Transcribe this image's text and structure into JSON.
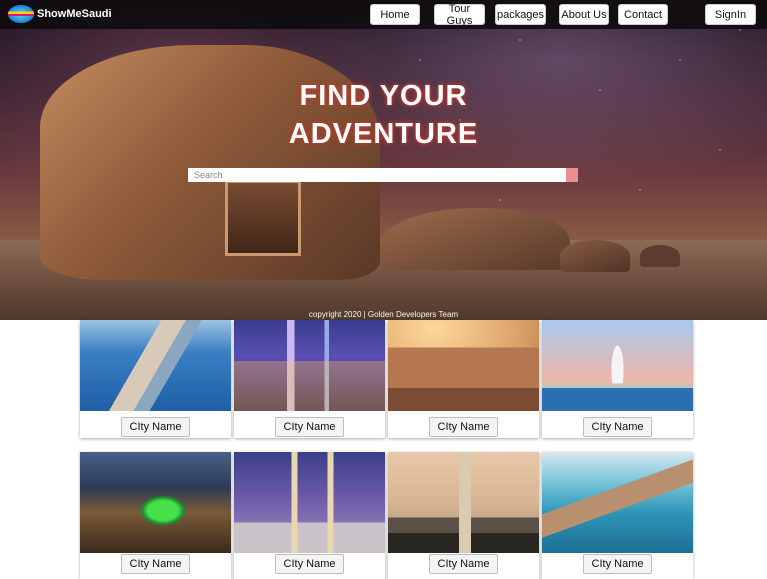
{
  "nav": {
    "brand": "ShowMeSaudi",
    "items": [
      {
        "label": "Home"
      },
      {
        "label": "Tour Guys"
      },
      {
        "label": "packages"
      },
      {
        "label": "About Us"
      },
      {
        "label": "Contact"
      }
    ],
    "signin": "SignIn"
  },
  "hero": {
    "title_line1": "FIND YOUR",
    "title_line2": "ADVENTURE",
    "search_placeholder": "Search",
    "copyright": "copyright 2020 | Golden Developers Team"
  },
  "cards": [
    {
      "button": "CIty Name",
      "image": "jeddah-corniche-aerial"
    },
    {
      "button": "CIty Name",
      "image": "riyadh-night-skyline"
    },
    {
      "button": "CIty Name",
      "image": "alula-tomb"
    },
    {
      "button": "CIty Name",
      "image": "khobar-water-tower"
    },
    {
      "button": "CIty Name",
      "image": "abha-green-lights"
    },
    {
      "button": "CIty Name",
      "image": "madinah-mosque"
    },
    {
      "button": "CIty Name",
      "image": "makkah-clock-tower"
    },
    {
      "button": "CIty Name",
      "image": "coastal-port-aerial"
    }
  ],
  "colors": {
    "nav_bg": "#0f0c0e",
    "title_glow": "#c0392b",
    "search_button": "#e8928f"
  }
}
